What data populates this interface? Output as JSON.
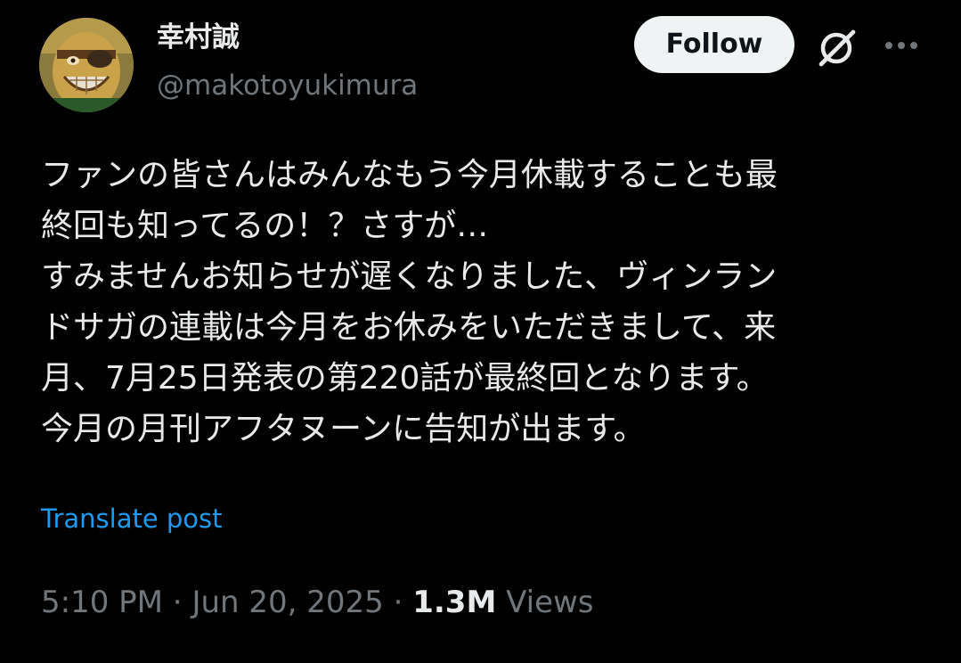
{
  "author": {
    "display_name": "幸村誠",
    "handle": "@makotoyukimura"
  },
  "actions": {
    "follow_label": "Follow",
    "grok_icon": "grok-icon",
    "more_icon": "more-horizontal-icon"
  },
  "post": {
    "lines": [
      "ファンの皆さんはみんなもう今月休載することも最",
      "終回も知ってるの！？さすが…",
      "すみませんお知らせが遅くなりました、ヴィンラン",
      "ドサガの連載は今月をお休みをいただきまして、来",
      "月、7月25日発表の第220話が最終回となります。",
      "今月の月刊アフタヌーンに告知が出ます。"
    ],
    "translate_label": "Translate post"
  },
  "meta": {
    "time": "5:10 PM",
    "separator1": " · ",
    "date": "Jun 20, 2025",
    "separator2": " · ",
    "views_count": "1.3M",
    "views_label": " Views"
  },
  "colors": {
    "background": "#000000",
    "text_primary": "#e7e9ea",
    "text_secondary": "#71767b",
    "link": "#1d9bf0",
    "follow_bg": "#eff3f4"
  }
}
